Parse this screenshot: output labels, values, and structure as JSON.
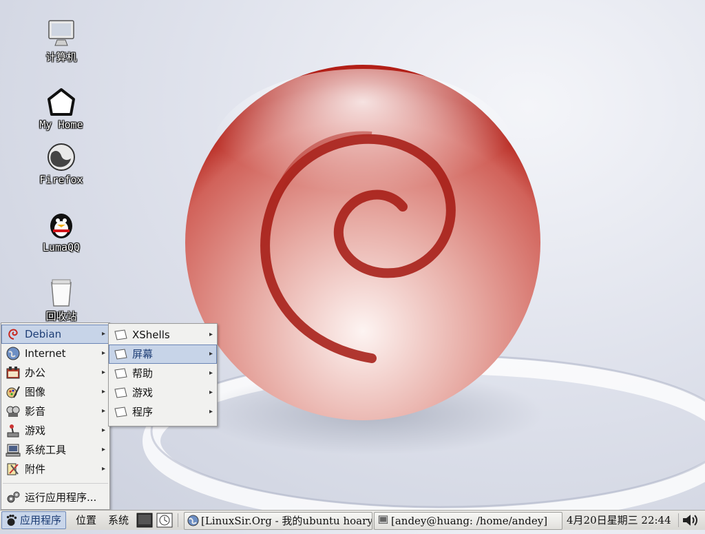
{
  "desktop": {
    "icons": [
      {
        "label": "计算机",
        "icon": "computer-icon"
      },
      {
        "label": "My Home",
        "icon": "home-icon"
      },
      {
        "label": "Firefox",
        "icon": "firefox-icon"
      },
      {
        "label": "LumaQQ",
        "icon": "lumaqq-icon"
      },
      {
        "label": "回收站",
        "icon": "trash-icon"
      }
    ]
  },
  "apps_menu": {
    "items": [
      {
        "label": "Debian",
        "icon": "debian-icon",
        "submenu": true,
        "highlighted": true
      },
      {
        "label": "Internet",
        "icon": "globe-icon",
        "submenu": true
      },
      {
        "label": "办公",
        "icon": "office-icon",
        "submenu": true
      },
      {
        "label": "图像",
        "icon": "graphics-icon",
        "submenu": true
      },
      {
        "label": "影音",
        "icon": "multimedia-icon",
        "submenu": true
      },
      {
        "label": "游戏",
        "icon": "joystick-icon",
        "submenu": true
      },
      {
        "label": "系统工具",
        "icon": "system-tools-icon",
        "submenu": true
      },
      {
        "label": "附件",
        "icon": "accessories-icon",
        "submenu": true
      }
    ],
    "run_label": "运行应用程序..."
  },
  "debian_submenu": {
    "items": [
      {
        "label": "XShells",
        "submenu": true
      },
      {
        "label": "屏幕",
        "submenu": true,
        "highlighted": true
      },
      {
        "label": "帮助",
        "submenu": true
      },
      {
        "label": "游戏",
        "submenu": true
      },
      {
        "label": "程序",
        "submenu": true
      }
    ]
  },
  "panel": {
    "applications": "应用程序",
    "places": "位置",
    "system": "系统",
    "tasks": [
      {
        "label": "[LinuxSir.Org - 我的ubuntu hoary...",
        "icon": "firefox-icon"
      },
      {
        "label": "[andey@huang: /home/andey]",
        "icon": "terminal-icon"
      }
    ],
    "clock": "4月20日星期三 22:44"
  },
  "colors": {
    "highlight": "#c7d4e8",
    "debian_red": "#c8281f"
  }
}
